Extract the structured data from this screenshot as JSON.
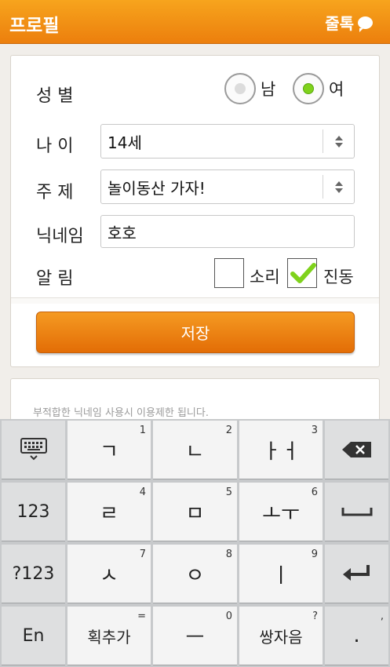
{
  "header": {
    "title": "프로필",
    "chat_label": "줄톡"
  },
  "form": {
    "gender": {
      "label": "성  별",
      "options": [
        {
          "label": "남",
          "selected": false
        },
        {
          "label": "여",
          "selected": true
        }
      ]
    },
    "age": {
      "label": "나  이",
      "value": "14세"
    },
    "topic": {
      "label": "주  제",
      "value": "놀이동산 가자!"
    },
    "nickname": {
      "label": "닉네임",
      "value": "호호"
    },
    "alert": {
      "label": "알  림",
      "sound_label": "소리",
      "sound_checked": false,
      "vibrate_label": "진동",
      "vibrate_checked": true
    },
    "save_label": "저장"
  },
  "notice": {
    "text": "부적합한 닉네임 사용시 이용제한 됩니다."
  },
  "keyboard": {
    "row1": {
      "k1": "ㄱ",
      "h1": "1",
      "k2": "ㄴ",
      "h2": "2",
      "k3": "ㅏㅓ",
      "h3": "3"
    },
    "row2": {
      "f": "123",
      "k1": "ㄹ",
      "h1": "4",
      "k2": "ㅁ",
      "h2": "5",
      "k3": "ㅗㅜ",
      "h3": "6"
    },
    "row3": {
      "f": "?123",
      "k1": "ㅅ",
      "h1": "7",
      "k2": "ㅇ",
      "h2": "8",
      "k3": "ㅣ",
      "h3": "9"
    },
    "row4": {
      "f": "En",
      "k1": "획추가",
      "h1": "=",
      "k2": "ㅡ",
      "h2": "0",
      "k3": "쌍자음",
      "h3": "?",
      "k4": ".",
      "h4": ","
    }
  },
  "colors": {
    "accent": "#ec7f0d",
    "check": "#7fd21c"
  }
}
